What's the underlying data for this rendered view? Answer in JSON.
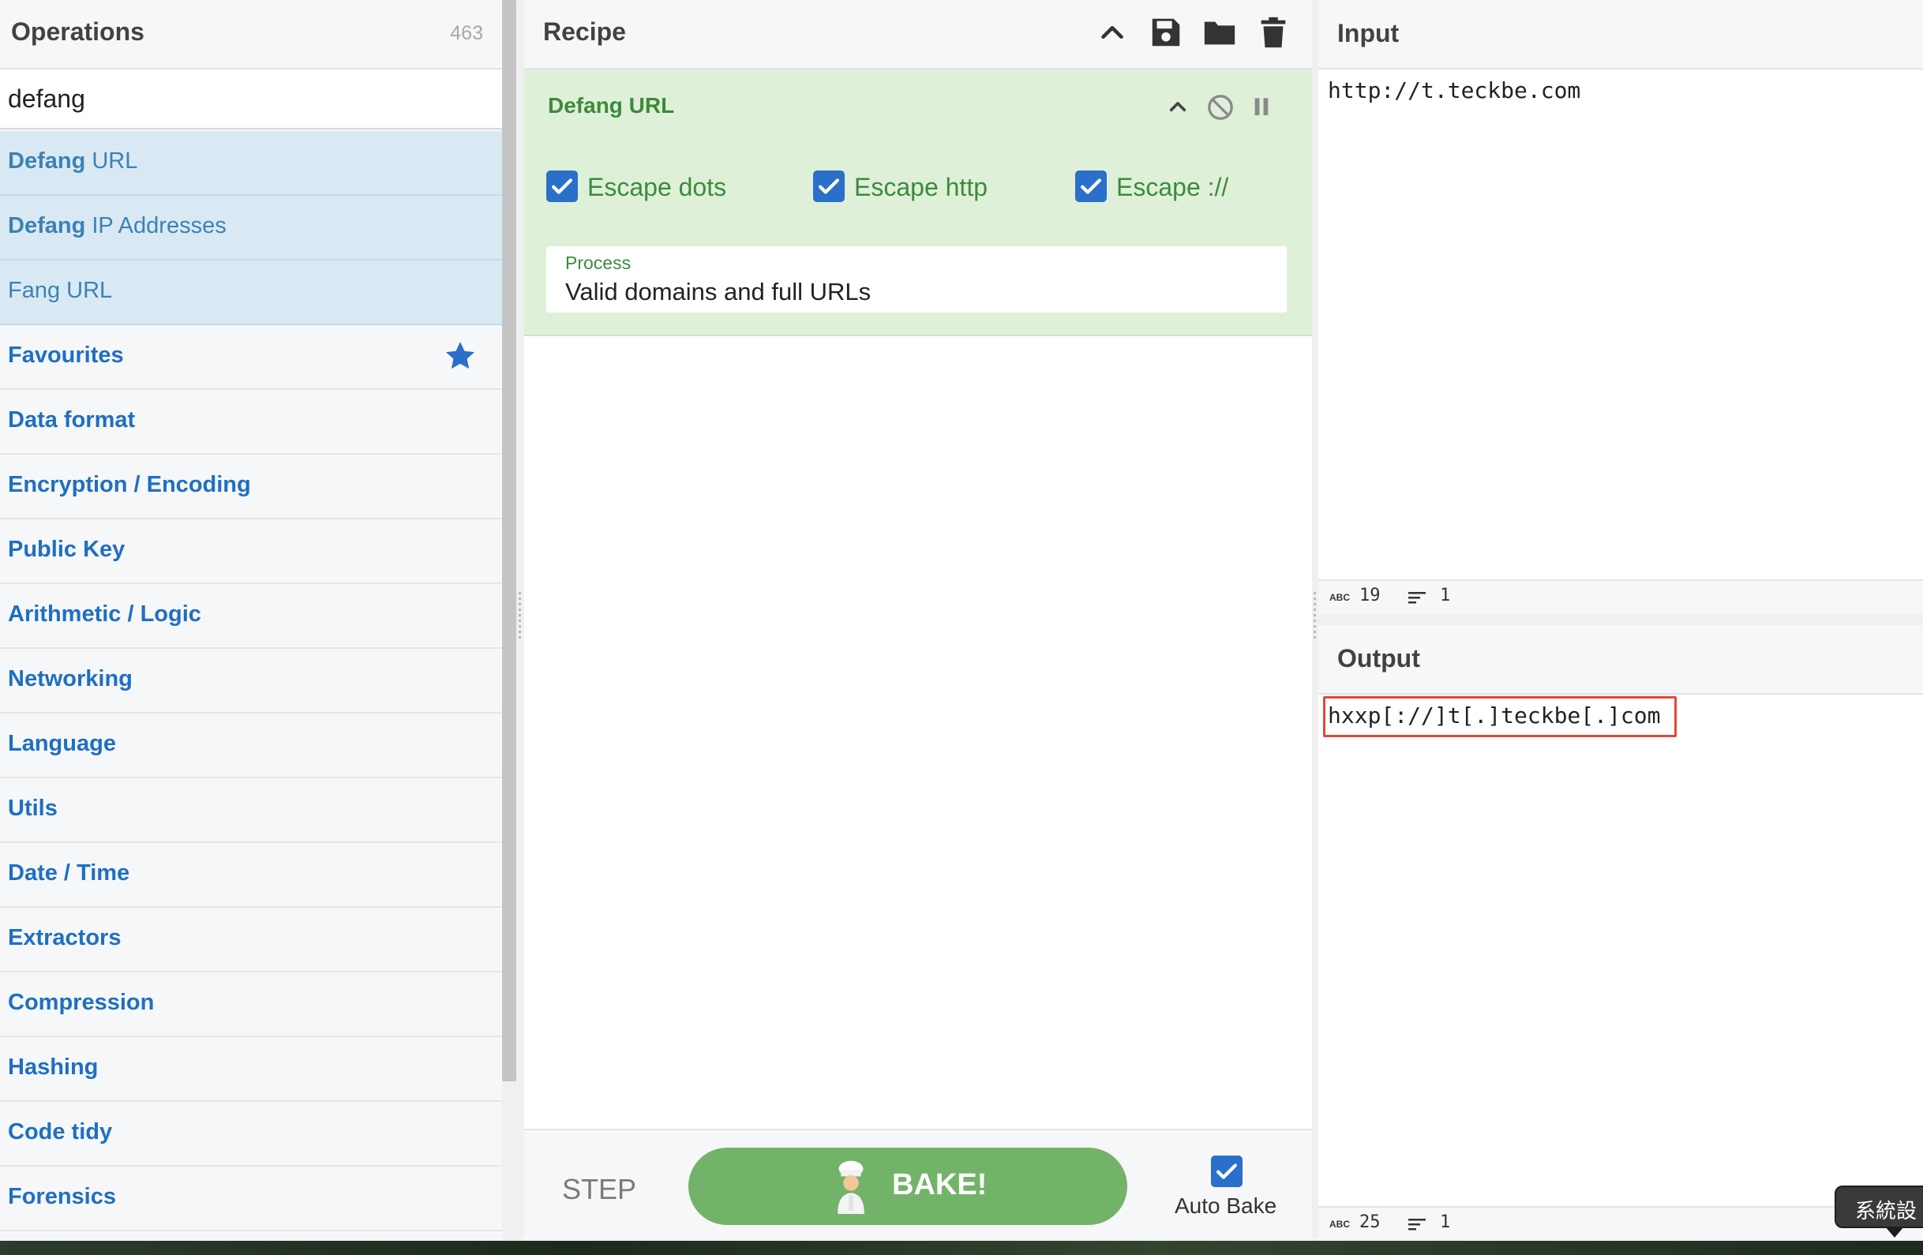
{
  "operations": {
    "title": "Operations",
    "count": "463",
    "search_value": "defang",
    "results": [
      {
        "bold": "Defang",
        "rest": " URL"
      },
      {
        "bold": "Defang",
        "rest": " IP Addresses"
      },
      {
        "bold": "",
        "rest": "Fang URL"
      }
    ],
    "categories": [
      "Favourites",
      "Data format",
      "Encryption / Encoding",
      "Public Key",
      "Arithmetic / Logic",
      "Networking",
      "Language",
      "Utils",
      "Date / Time",
      "Extractors",
      "Compression",
      "Hashing",
      "Code tidy",
      "Forensics"
    ]
  },
  "recipe": {
    "title": "Recipe",
    "op_name": "Defang URL",
    "options": [
      "Escape dots",
      "Escape http",
      "Escape ://"
    ],
    "process_label": "Process",
    "process_value": "Valid domains and full URLs",
    "step_label": "STEP",
    "bake_label": "BAKE!",
    "auto_bake_label": "Auto Bake"
  },
  "input": {
    "title": "Input",
    "text": "http://t.teckbe.com",
    "chars": "19",
    "lines": "1"
  },
  "output": {
    "title": "Output",
    "text": "hxxp[://]t[.]teckbe[.]com",
    "chars": "25",
    "lines": "1"
  },
  "status_abbr": "ABC",
  "tooltip": "系統設",
  "colors": {
    "accent_blue": "#2a6fc9",
    "recipe_green": "#3c8b3c",
    "bake_green": "#73b369",
    "highlight_red": "#e04a3a"
  }
}
